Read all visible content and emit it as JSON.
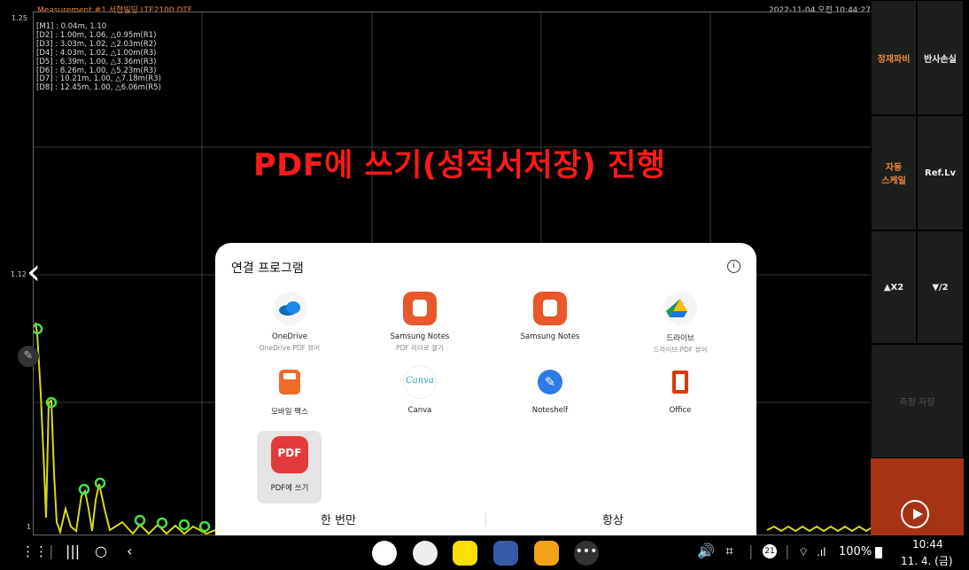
{
  "header": {
    "measurement": "Measurement #1 서현빌딩 LTE2100 DTF",
    "datetime": "2022-11-04 오전 10:44:27"
  },
  "plot": {
    "y_top": "1.25",
    "y_mid": "1.12",
    "y_bottom": "1",
    "markers": [
      "[M1] : 0.04m, 1.10",
      "[D2] : 1.00m, 1.06, △0.95m(R1)",
      "[D3] : 3.03m, 1.02, △2.03m(R2)",
      "[D4] : 4.03m, 1.02, △1.00m(R3)",
      "[D5] : 6.39m, 1.00, △3.36m(R3)",
      "[D6] : 8.26m, 1.00, △5.23m(R3)",
      "[D7] : 10.21m, 1.00, △7.18m(R3)",
      "[D8] : 12.45m, 1.00, △6.06m(R5)"
    ]
  },
  "banner": "PDF에 쓰기(성적서저장) 진행",
  "sidebar": {
    "vswr": "정재파비",
    "return_loss": "반사손실",
    "auto_scale": "자동\n스케일",
    "ref_level": "Ref.Lv",
    "x2": "▲X2",
    "div2": "▼/2",
    "save_measure": "측정 저장"
  },
  "dialog": {
    "title": "연결 프로그램",
    "apps": [
      {
        "name": "OneDrive",
        "sub": "OneDrive PDF 뷰어",
        "icon": "onedrive-icon"
      },
      {
        "name": "Samsung Notes",
        "sub": "PDF 리더로 열기",
        "icon": "samsung-notes-icon"
      },
      {
        "name": "Samsung Notes",
        "sub": "",
        "icon": "samsung-notes-icon"
      },
      {
        "name": "드라이브",
        "sub": "드라이브 PDF 뷰어",
        "icon": "google-drive-icon"
      },
      {
        "name": "모바일 팩스",
        "sub": "",
        "icon": "fax-icon"
      },
      {
        "name": "Canva",
        "sub": "",
        "icon": "canva-icon"
      },
      {
        "name": "Noteshelf",
        "sub": "",
        "icon": "noteshelf-icon"
      },
      {
        "name": "Office",
        "sub": "",
        "icon": "office-icon"
      },
      {
        "name": "PDF에 쓰기",
        "sub": "",
        "icon": "pdf-write-icon"
      }
    ],
    "once": "한 번만",
    "always": "항상"
  },
  "status": {
    "notification_count": "21",
    "battery": "100%",
    "time": "10:44",
    "date": "11. 4. (금)"
  },
  "colors": {
    "trace": "#d8d820",
    "marker": "#49e046",
    "banner": "#ff1a1a",
    "accent_orange": "#f0883e",
    "play_bg": "#a63314"
  }
}
